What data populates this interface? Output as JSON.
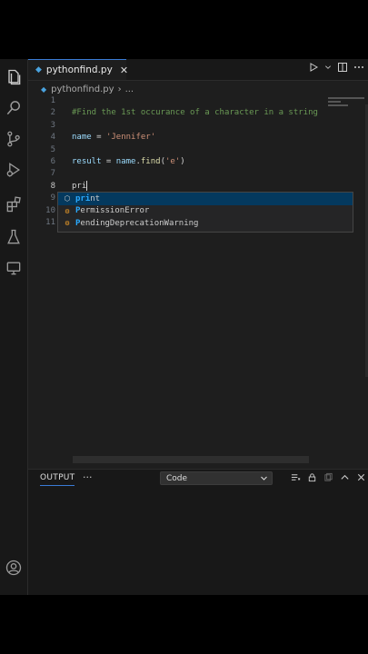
{
  "editor": {
    "tab_title": "pythonfind.py",
    "tab_icon_glyph": "◆",
    "breadcrumb": {
      "file": "pythonfind.py",
      "sep": "›",
      "more": "..."
    },
    "line_numbers": [
      "1",
      "2",
      "3",
      "4",
      "5",
      "6",
      "7",
      "8",
      "9",
      "10",
      "11"
    ],
    "current_line": "8",
    "code": {
      "comment": "#Find the 1st occurance of a character in a string",
      "name_var": "name",
      "name_eq": " = ",
      "name_val": "'Jennifer'",
      "result_var": "result",
      "result_eq": " = ",
      "result_obj": "name",
      "result_dot": ".",
      "result_fn": "find",
      "result_open": "(",
      "result_arg": "'e'",
      "result_close": ")",
      "typed": "pri"
    }
  },
  "suggestions": [
    {
      "icon": "method-icon",
      "match": "pri",
      "rest": "nt"
    },
    {
      "icon": "class-icon",
      "match": "P",
      "rest": "ermissionError"
    },
    {
      "icon": "class-icon",
      "match": "P",
      "rest": "endingDeprecationWarning"
    }
  ],
  "panel": {
    "output_label": "OUTPUT",
    "more": "···",
    "channel": "Code"
  },
  "colors": {
    "accent": "#3a7bd5",
    "comment": "#6a9955",
    "string": "#ce9178",
    "variable": "#9cdcfe",
    "function": "#dcdcaa"
  }
}
